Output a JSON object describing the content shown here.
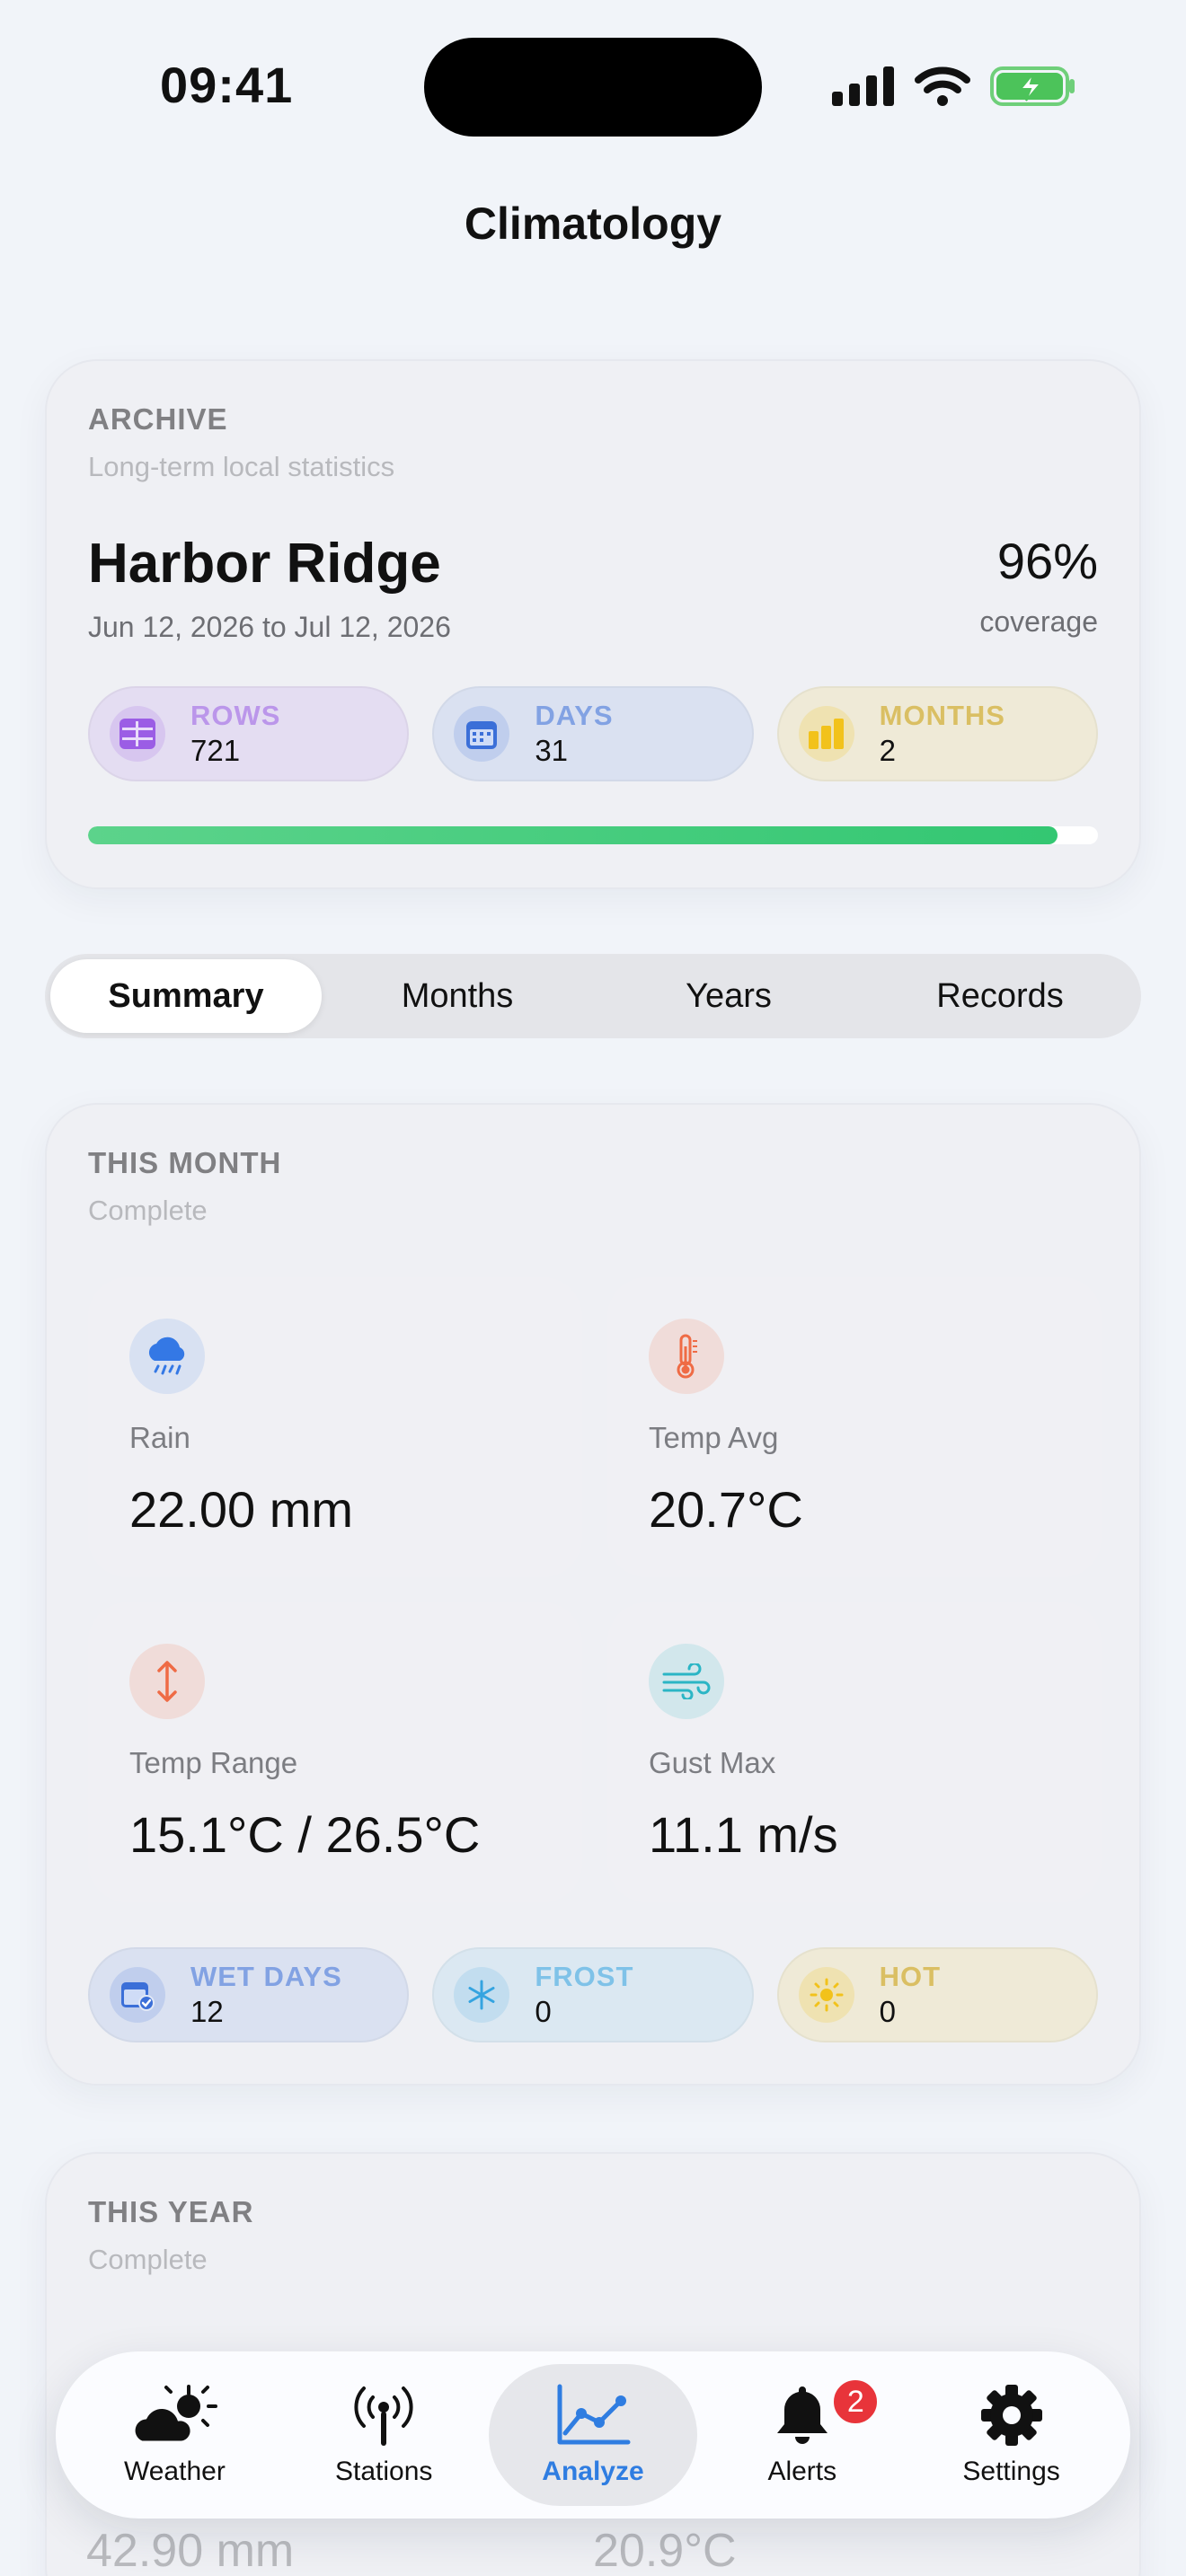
{
  "status_bar": {
    "time": "09:41"
  },
  "header": {
    "title": "Climatology"
  },
  "archive": {
    "eyebrow": "ARCHIVE",
    "subtitle": "Long-term local statistics",
    "station": "Harbor Ridge",
    "date_range": "Jun 12, 2026 to Jul 12, 2026",
    "coverage_value": "96%",
    "coverage_label": "coverage",
    "coverage_fraction": 0.96,
    "chips": [
      {
        "label": "ROWS",
        "value": "721",
        "icon": "table-icon",
        "color": "#9b5de5"
      },
      {
        "label": "DAYS",
        "value": "31",
        "icon": "calendar-icon",
        "color": "#3b6fd8"
      },
      {
        "label": "MONTHS",
        "value": "2",
        "icon": "bar-chart-icon",
        "color": "#f2c21b"
      }
    ]
  },
  "segments": [
    "Summary",
    "Months",
    "Years",
    "Records"
  ],
  "active_segment": "Summary",
  "this_month": {
    "eyebrow": "THIS MONTH",
    "status": "Complete",
    "tiles": [
      {
        "label": "Rain",
        "value": "22.00 mm",
        "icon": "cloud-rain-icon",
        "color": "#3478e5"
      },
      {
        "label": "Temp Avg",
        "value": "20.7°C",
        "icon": "thermometer-icon",
        "color": "#ef6b45"
      },
      {
        "label": "Temp Range",
        "value": "15.1°C / 26.5°C",
        "icon": "up-down-arrows-icon",
        "color": "#ef6b45"
      },
      {
        "label": "Gust Max",
        "value": "11.1 m/s",
        "icon": "wind-icon",
        "color": "#2bb5c5"
      }
    ],
    "chips": [
      {
        "label": "WET DAYS",
        "value": "12",
        "icon": "calendar-check-icon",
        "color": "#3b6fd8"
      },
      {
        "label": "FROST",
        "value": "0",
        "icon": "snowflake-icon",
        "color": "#35a4e0"
      },
      {
        "label": "HOT",
        "value": "0",
        "icon": "sun-icon",
        "color": "#f2c21b"
      }
    ]
  },
  "this_year": {
    "eyebrow": "THIS YEAR",
    "status": "Complete",
    "values": [
      "42.90 mm",
      "20.9°C"
    ]
  },
  "tabbar": {
    "items": [
      {
        "label": "Weather",
        "icon": "cloud-sun-icon"
      },
      {
        "label": "Stations",
        "icon": "antenna-icon"
      },
      {
        "label": "Analyze",
        "icon": "line-chart-icon"
      },
      {
        "label": "Alerts",
        "icon": "bell-icon",
        "badge": "2"
      },
      {
        "label": "Settings",
        "icon": "gear-icon"
      }
    ],
    "active": "Analyze",
    "accent": "#2f7de1"
  }
}
